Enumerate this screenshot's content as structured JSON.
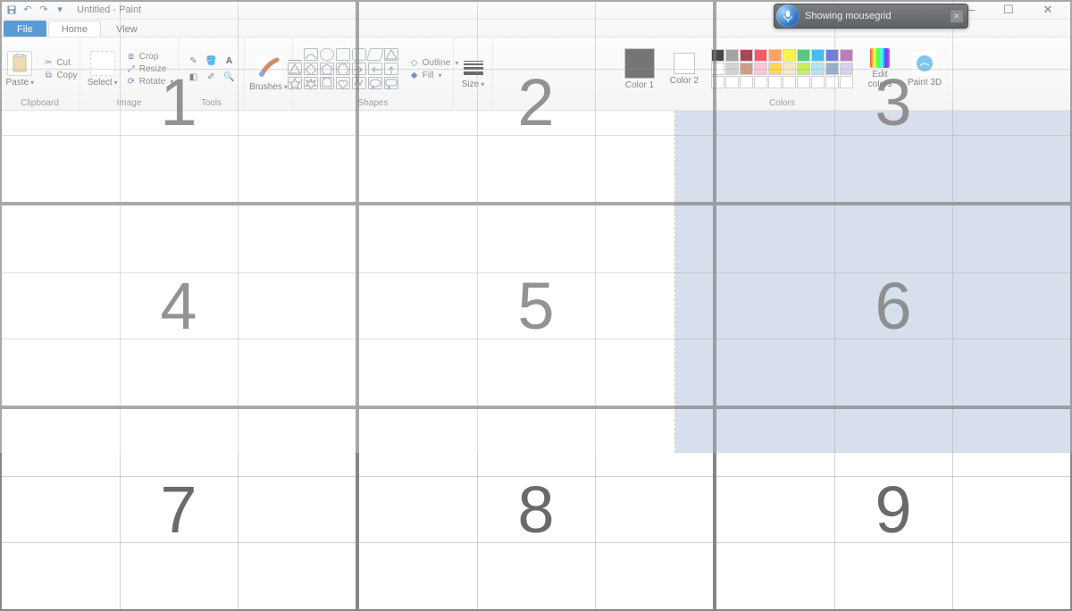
{
  "window": {
    "title": "Untitled - Paint"
  },
  "qat": {
    "save_tip": "Save",
    "undo_tip": "Undo",
    "redo_tip": "Redo"
  },
  "win_controls": {
    "min": "—",
    "max": "☐",
    "close": "✕"
  },
  "tabs": {
    "file": "File",
    "home": "Home",
    "view": "View"
  },
  "ribbon": {
    "clipboard": {
      "label": "Clipboard",
      "paste": "Paste",
      "cut": "Cut",
      "copy": "Copy"
    },
    "image": {
      "label": "Image",
      "select": "Select",
      "crop": "Crop",
      "resize": "Resize",
      "rotate": "Rotate"
    },
    "tools": {
      "label": "Tools"
    },
    "brushes": {
      "label": "Brushes",
      "btn": "Brushes"
    },
    "shapes": {
      "label": "Shapes",
      "outline": "Outline",
      "fill": "Fill"
    },
    "size": {
      "label": "Size",
      "btn": "Size"
    },
    "colors": {
      "label": "Colors",
      "color1": "Color 1",
      "color2": "Color 2",
      "edit": "Edit colors",
      "p3d": "Paint 3D"
    }
  },
  "palette_colors": [
    "#000000",
    "#7f7f7f",
    "#880015",
    "#ed1c24",
    "#ff7f27",
    "#fff200",
    "#22b14c",
    "#00a2e8",
    "#3f48cc",
    "#a349a4",
    "#ffffff",
    "#c3c3c3",
    "#b97a57",
    "#ffaec9",
    "#ffc90e",
    "#efe4b0",
    "#b5e61d",
    "#99d9ea",
    "#7092be",
    "#c8bfe7",
    "#ffffff",
    "#ffffff",
    "#ffffff",
    "#ffffff",
    "#ffffff",
    "#ffffff",
    "#ffffff",
    "#ffffff",
    "#ffffff",
    "#ffffff"
  ],
  "color1_value": "#404040",
  "color2_value": "#ffffff",
  "speech": {
    "status": "Showing mousegrid",
    "close": "✕"
  },
  "mousegrid": {
    "cells": [
      "1",
      "2",
      "3",
      "4",
      "5",
      "6",
      "7",
      "8",
      "9"
    ]
  }
}
